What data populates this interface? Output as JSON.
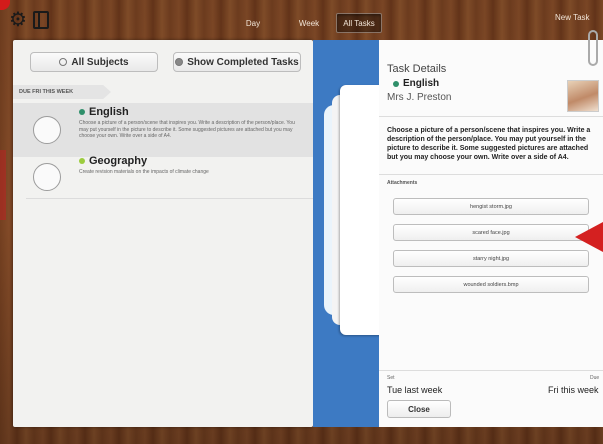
{
  "toolbar": {
    "icons": [
      "gear-icon",
      "book-icon"
    ],
    "segments": {
      "day": "Day",
      "week": "Week",
      "all": "All Tasks"
    },
    "new_task": "New Task"
  },
  "left": {
    "all_subjects": "All Subjects",
    "show_completed": "Show Completed Tasks",
    "section": "DUE FRI THIS WEEK",
    "tasks": [
      {
        "subject": "English",
        "color": "#2f8f6a",
        "desc": "Choose a picture of a person/scene that inspires you.  Write a description of the person/place.  You may put yourself in the picture to describe it. Some suggested pictures are attached but you may choose your own. Write over a side of A4."
      },
      {
        "subject": "Geography",
        "color": "#9ccc3e",
        "desc": "Create revision materials on the impacts of climate change"
      }
    ]
  },
  "details": {
    "title": "Task Details",
    "subject": "English",
    "subject_color": "#2f8f6a",
    "teacher": "Mrs J. Preston",
    "desc": "Choose a picture of a person/scene that inspires you.  Write a description of the person/place. You may put yourself in the picture to describe it. Some suggested pictures are attached but you may choose your own. Write over a side of A4.",
    "attachments_label": "Attachments",
    "attachments": [
      "hengist storm.jpg",
      "scared face.jpg",
      "starry night.jpg",
      "wounded soldiers.bmp"
    ],
    "set_label": "Set",
    "set_value": "Tue last week",
    "due_label": "Due",
    "due_value": "Fri this week",
    "close": "Close"
  }
}
